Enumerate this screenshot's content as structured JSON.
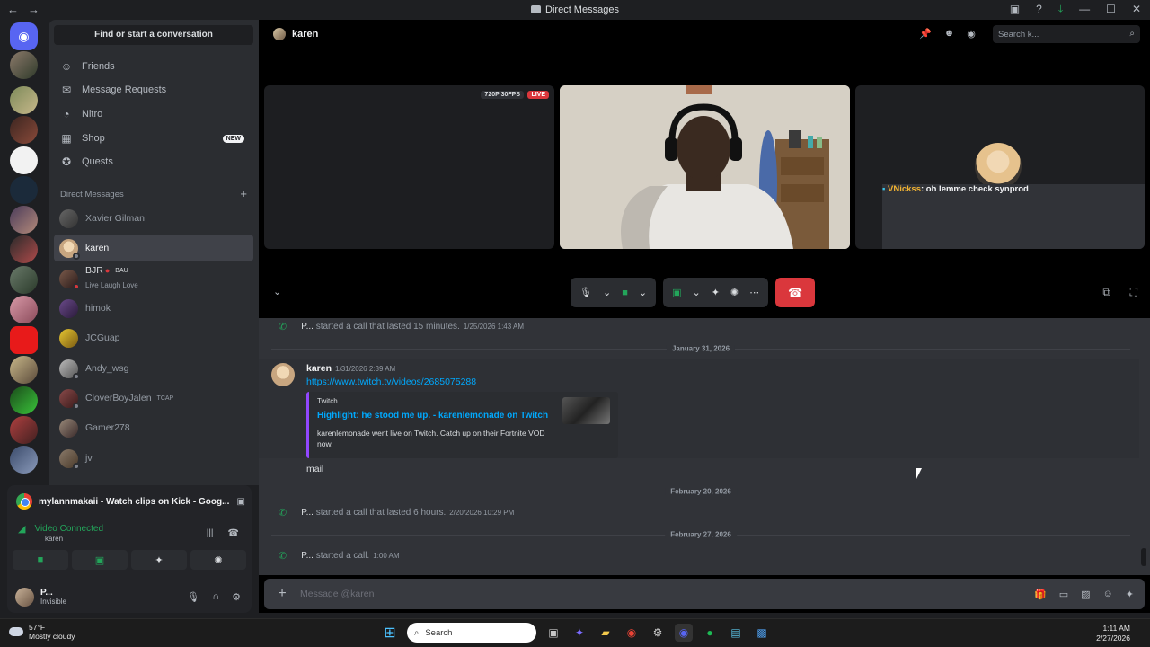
{
  "window": {
    "title": "Direct Messages"
  },
  "sidebar": {
    "find_label": "Find or start a conversation",
    "nav": [
      {
        "label": "Friends",
        "icon": "friends-icon"
      },
      {
        "label": "Message Requests",
        "icon": "envelope-icon"
      },
      {
        "label": "Nitro",
        "icon": "nitro-icon"
      },
      {
        "label": "Shop",
        "icon": "shop-icon",
        "badge": "NEW"
      },
      {
        "label": "Quests",
        "icon": "quests-icon"
      }
    ],
    "dm_header": "Direct Messages",
    "dms": [
      {
        "name": "Xavier Gilman"
      },
      {
        "name": "karen",
        "active": true
      },
      {
        "name": "BJR",
        "tag": "BAU",
        "sub": "Live Laugh Love"
      },
      {
        "name": "himok"
      },
      {
        "name": "JCGuap"
      },
      {
        "name": "Andy_wsg"
      },
      {
        "name": "CloverBoyJalen",
        "tag": "TCAP"
      },
      {
        "name": "Gamer278"
      },
      {
        "name": "jv"
      }
    ]
  },
  "voice": {
    "activity": "mylannmakaii - Watch clips on Kick - Goog...",
    "status": "Video Connected",
    "channel": "karen"
  },
  "user": {
    "name": "P...",
    "status": "Invisible"
  },
  "header": {
    "dm_name": "karen",
    "search_placeholder": "Search k..."
  },
  "stream": {
    "quality": "720P 30FPS",
    "live_label": "LIVE"
  },
  "tile3": {
    "chat_user": "VNickss",
    "chat_text": ": oh lemme check synprod"
  },
  "messages": {
    "call1": {
      "user": "P...",
      "text": "started a call that lasted 15 minutes.",
      "ts": "1/25/2026 1:43 AM"
    },
    "date1": "January 31, 2026",
    "msg": {
      "author": "karen",
      "ts": "1/31/2026 2:39 AM",
      "link": "https://www.twitch.tv/videos/2685075288",
      "embed_provider": "Twitch",
      "embed_title": "Highlight: he stood me up. - karenlemonade on Twitch",
      "embed_desc": "karenlemonade went live on Twitch. Catch up on their Fortnite VOD now.",
      "followup": "mail"
    },
    "date2": "February 20, 2026",
    "call2": {
      "user": "P...",
      "text": "started a call that lasted 6 hours.",
      "ts": "2/20/2026 10:29 PM"
    },
    "date3": "February 27, 2026",
    "call3": {
      "user": "P...",
      "text": "started a call.",
      "ts": "1:00 AM"
    }
  },
  "composer": {
    "placeholder": "Message @karen"
  },
  "taskbar": {
    "temp": "57°F",
    "weather": "Mostly cloudy",
    "search": "Search",
    "time": "1:11 AM",
    "date": "2/27/2026"
  }
}
